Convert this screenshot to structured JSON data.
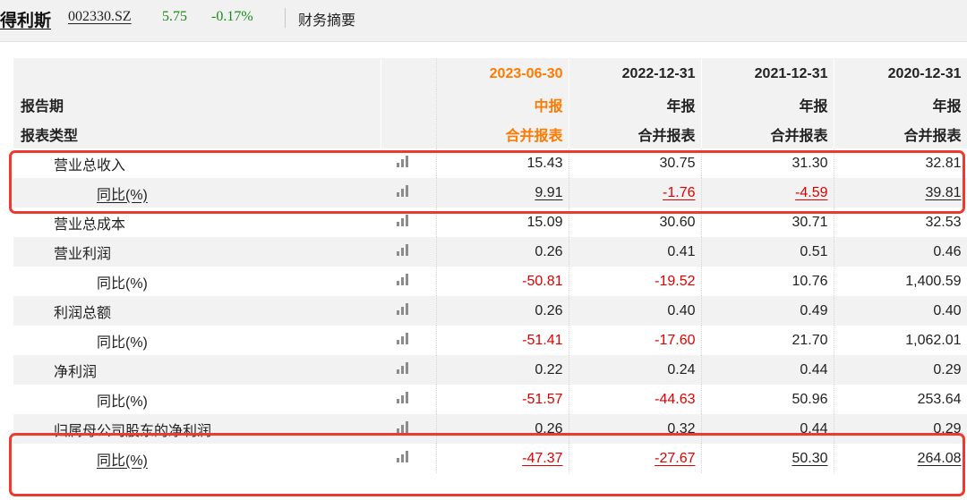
{
  "header": {
    "stock_name": "得利斯",
    "stock_code": "002330.SZ",
    "price": "5.75",
    "change": "-0.17%",
    "section_title": "财务摘要"
  },
  "colors": {
    "accent_orange": "#ff7a00",
    "negative_red": "#e00000",
    "positive_green": "#1a8c1a",
    "highlight_box": "#ee3a2e"
  },
  "table": {
    "periods": [
      "2023-06-30",
      "2022-12-31",
      "2021-12-31",
      "2020-12-31"
    ],
    "report_period_label": "报告期",
    "report_type_label": "报表类型",
    "report_periods": [
      "中报",
      "年报",
      "年报",
      "年报"
    ],
    "report_types": [
      "合并报表",
      "合并报表",
      "合并报表",
      "合并报表"
    ],
    "rows": [
      {
        "label": "营业总收入",
        "sub": false,
        "values": [
          "15.43",
          "30.75",
          "31.30",
          "32.81"
        ]
      },
      {
        "label": "同比(%)",
        "sub": true,
        "values": [
          "9.91",
          "-1.76",
          "-4.59",
          "39.81"
        ]
      },
      {
        "label": "营业总成本",
        "sub": false,
        "values": [
          "15.09",
          "30.60",
          "30.71",
          "32.53"
        ]
      },
      {
        "label": "营业利润",
        "sub": false,
        "values": [
          "0.26",
          "0.41",
          "0.51",
          "0.46"
        ]
      },
      {
        "label": "同比(%)",
        "sub": true,
        "values": [
          "-50.81",
          "-19.52",
          "10.76",
          "1,400.59"
        ]
      },
      {
        "label": "利润总额",
        "sub": false,
        "values": [
          "0.26",
          "0.40",
          "0.49",
          "0.40"
        ]
      },
      {
        "label": "同比(%)",
        "sub": true,
        "values": [
          "-51.41",
          "-17.60",
          "21.70",
          "1,062.01"
        ]
      },
      {
        "label": "净利润",
        "sub": false,
        "values": [
          "0.22",
          "0.24",
          "0.44",
          "0.29"
        ]
      },
      {
        "label": "同比(%)",
        "sub": true,
        "values": [
          "-51.57",
          "-44.63",
          "50.96",
          "253.64"
        ]
      },
      {
        "label": "归属母公司股东的净利润",
        "sub": false,
        "values": [
          "0.26",
          "0.32",
          "0.44",
          "0.29"
        ]
      },
      {
        "label": "同比(%)",
        "sub": true,
        "values": [
          "-47.37",
          "-27.67",
          "50.30",
          "264.08"
        ]
      }
    ]
  },
  "chart_icon": "bar-chart-icon"
}
